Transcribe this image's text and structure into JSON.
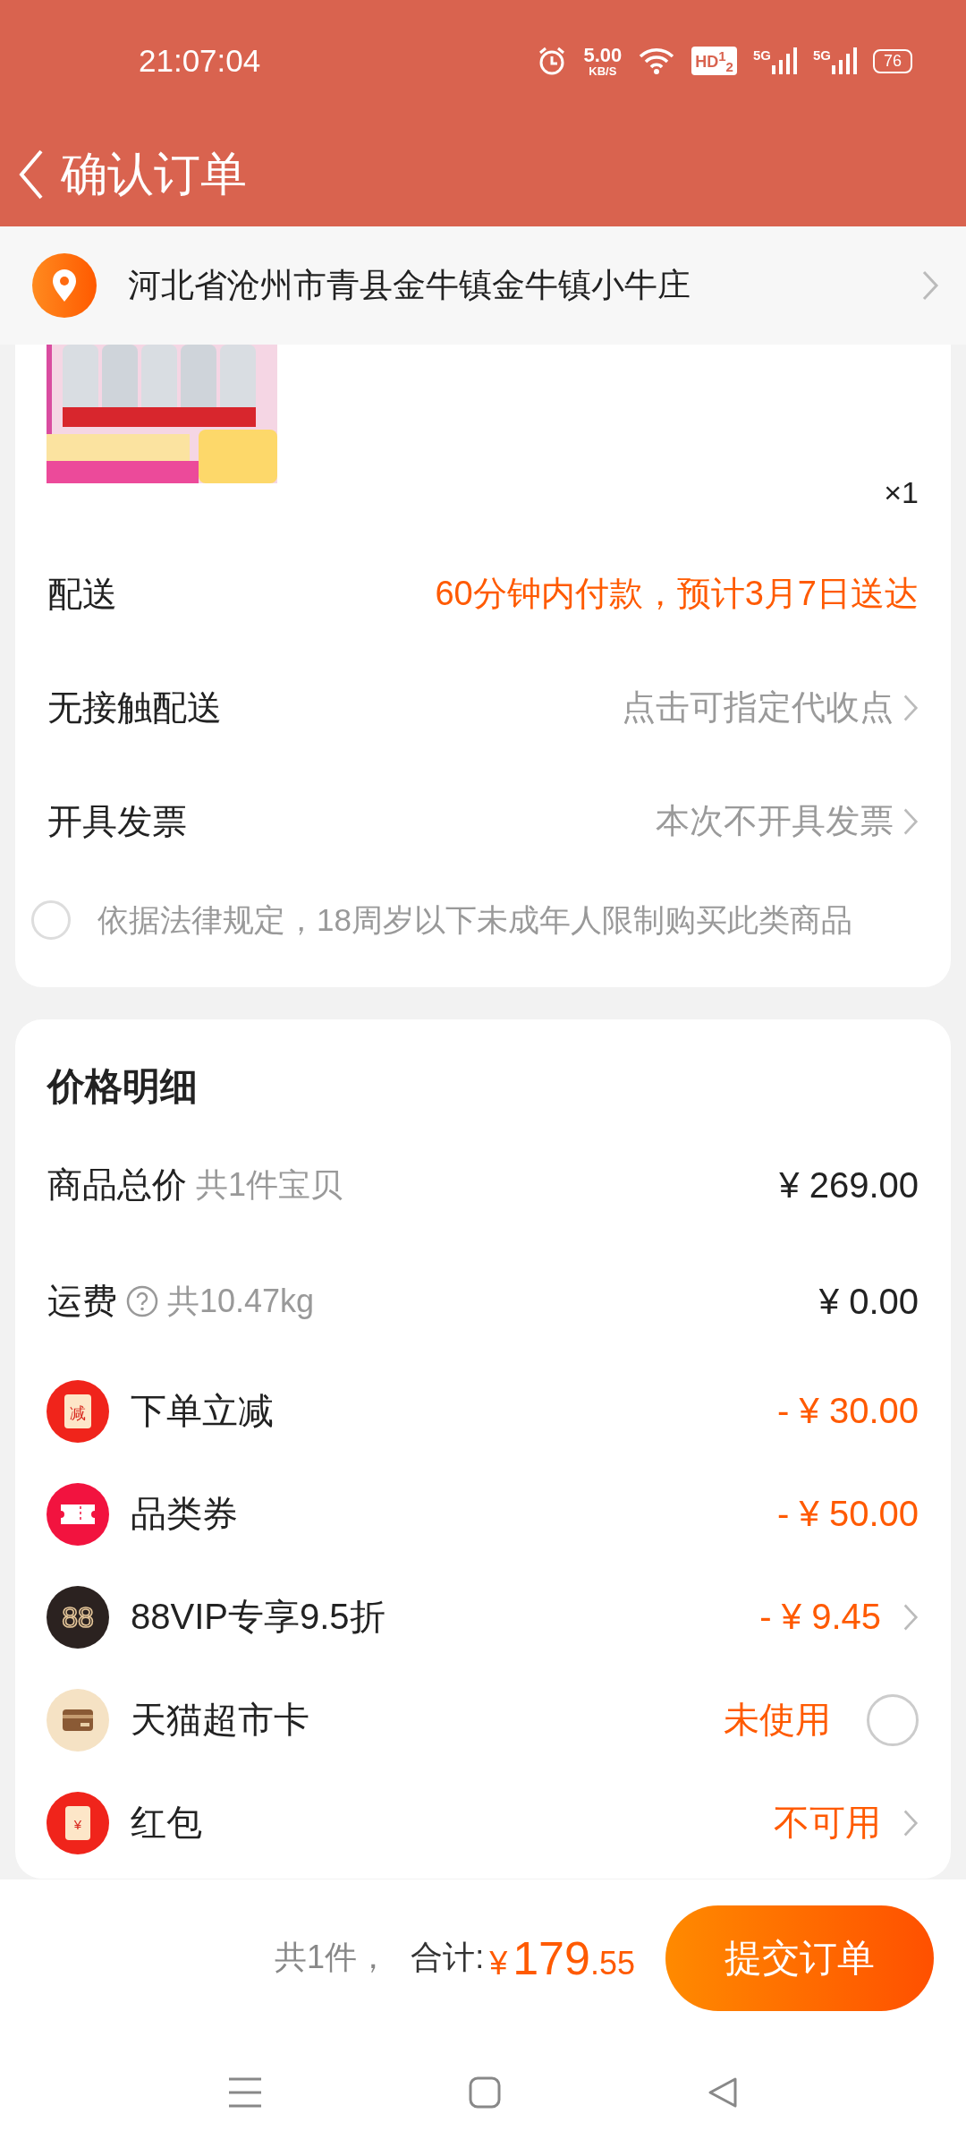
{
  "status_bar": {
    "time": "21:07:04",
    "net_speed": "5.00",
    "net_unit": "KB/S",
    "hd_badge": "HD$^{1}$$_{2}$",
    "signals": [
      "5G",
      "5G"
    ],
    "battery": "76"
  },
  "header": {
    "title": "确认订单"
  },
  "address": {
    "text": "河北省沧州市青县金牛镇金牛镇小牛庄"
  },
  "product": {
    "quantity": "×1"
  },
  "info_rows": [
    {
      "label": "配送",
      "value": "60分钟内付款，预计3月7日送达",
      "highlight": true,
      "chevron": false
    },
    {
      "label": "无接触配送",
      "value": "点击可指定代收点",
      "highlight": false,
      "chevron": true
    },
    {
      "label": "开具发票",
      "value": "本次不开具发票",
      "highlight": false,
      "chevron": true
    }
  ],
  "consent": {
    "text": "依据法律规定，18周岁以下未成年人限制购买此类商品",
    "checked": false
  },
  "price_detail": {
    "title": "价格明细",
    "summary_rows": [
      {
        "label": "商品总价",
        "note": "共1件宝贝",
        "help": false,
        "amount": "¥ 269.00"
      },
      {
        "label": "运费",
        "note": "共10.47kg",
        "help": true,
        "amount": "¥ 0.00"
      }
    ],
    "discount_rows": [
      {
        "kind": "instant",
        "icon_text": "减",
        "label": "下单立减",
        "amount": "- ¥ 30.00",
        "chevron": false
      },
      {
        "kind": "coupon",
        "label": "品类券",
        "amount": "- ¥ 50.00",
        "chevron": false
      },
      {
        "kind": "vip",
        "icon_text": "88",
        "label": "88VIP专享9.5折",
        "amount": "- ¥ 9.45",
        "chevron": true
      },
      {
        "kind": "card",
        "label": "天猫超市卡",
        "amount": "未使用",
        "chevron": false,
        "checked": false
      },
      {
        "kind": "envelope",
        "icon_text": "¥",
        "label": "红包",
        "amount": "不可用",
        "chevron": true
      }
    ]
  },
  "footer": {
    "count": "共1件，",
    "total_label": "合计:",
    "currency": "¥",
    "total_int": "179",
    "total_dec": ".55",
    "submit": "提交订单"
  }
}
